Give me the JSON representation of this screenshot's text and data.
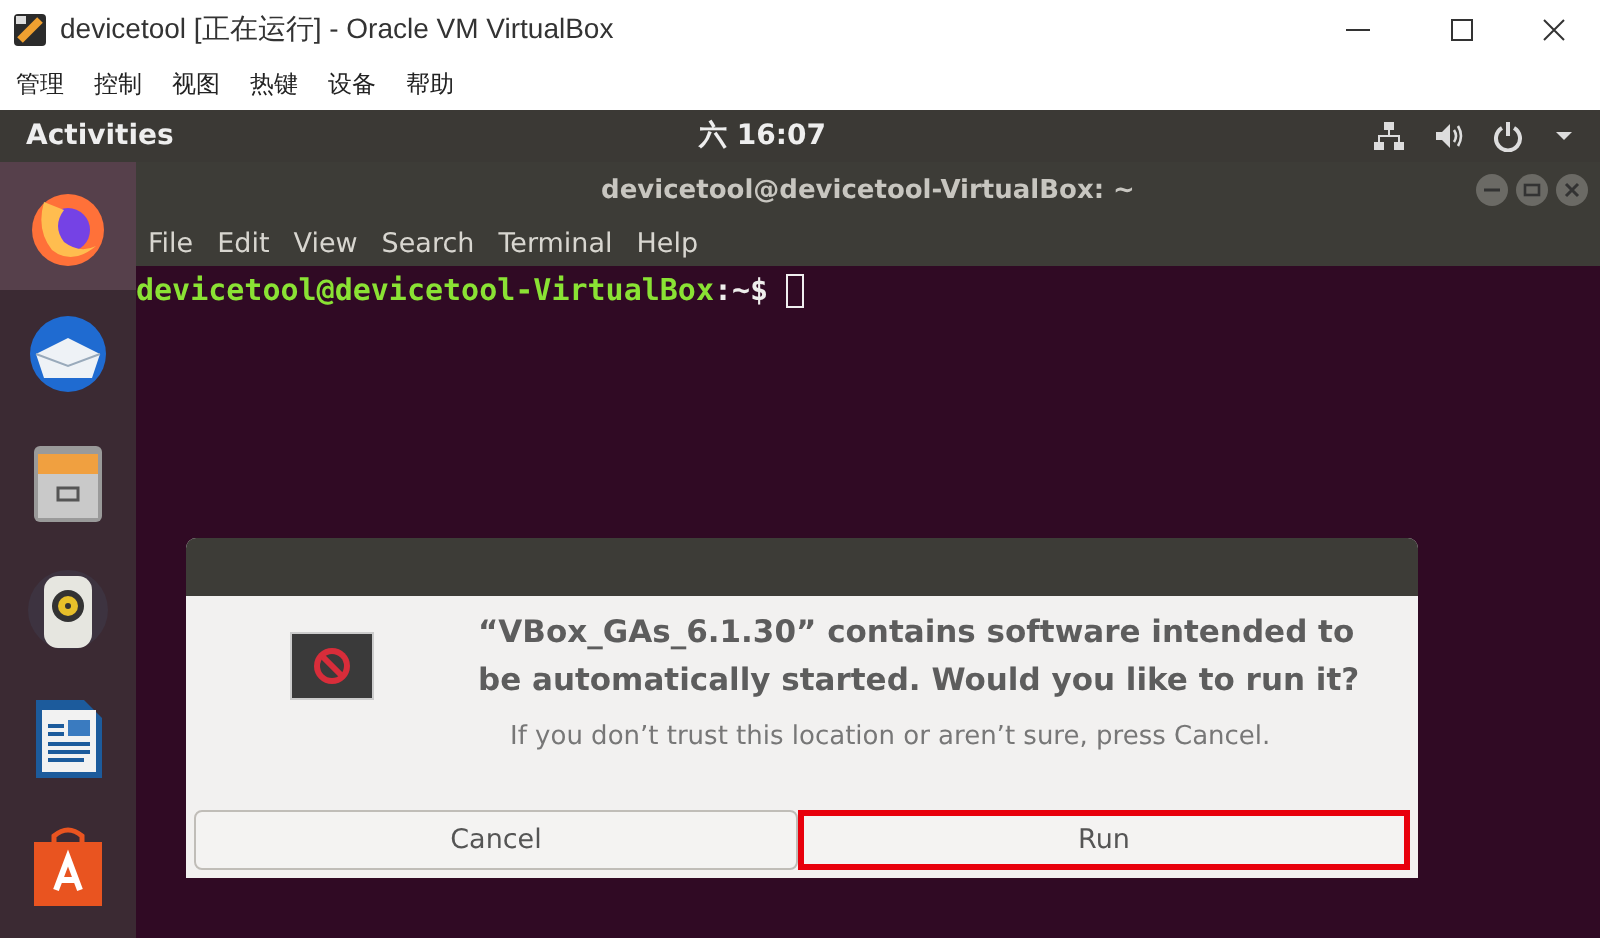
{
  "window": {
    "title": "devicetool [正在运行] - Oracle VM VirtualBox"
  },
  "menu": [
    "管理",
    "控制",
    "视图",
    "热键",
    "设备",
    "帮助"
  ],
  "top_bar": {
    "activities": "Activities",
    "clock": "六 16:07"
  },
  "dock": [
    {
      "selected": true
    },
    {
      "selected": false
    },
    {
      "selected": false
    },
    {
      "selected": false
    },
    {
      "selected": false
    },
    {
      "selected": false
    }
  ],
  "terminal": {
    "title": "devicetool@devicetool-VirtualBox: ~",
    "menu": [
      "File",
      "Edit",
      "View",
      "Search",
      "Terminal",
      "Help"
    ],
    "prompt_user": "devicetool@devicetool-VirtualBox",
    "prompt_path": ":~$"
  },
  "dialog": {
    "heading": "“VBox_GAs_6.1.30” contains software intended to be automatically started. Would you like to run it?",
    "message": "If you don’t trust this location or aren’t sure, press Cancel.",
    "buttons": [
      {
        "label": "Cancel",
        "highlighted": false
      },
      {
        "label": "Run",
        "highlighted": true
      }
    ]
  }
}
